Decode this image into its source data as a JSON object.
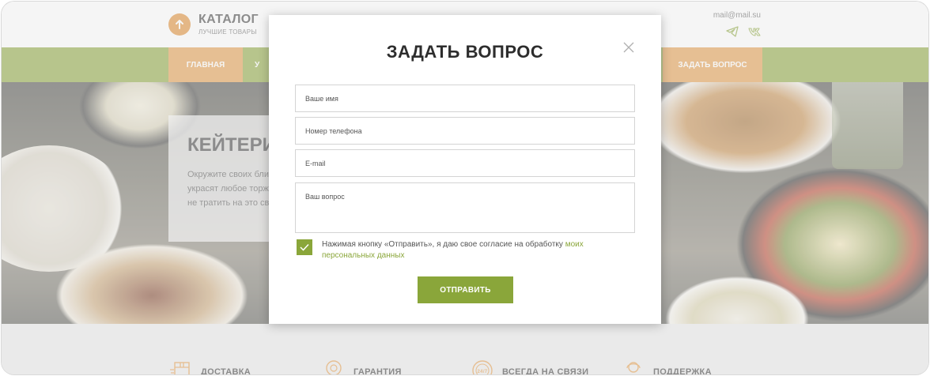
{
  "header": {
    "logo_title": "КАТАЛОГ",
    "logo_subtitle": "ЛУЧШИЕ ТОВАРЫ",
    "email": "mail@mail.su"
  },
  "nav": {
    "home": "ГЛАВНАЯ",
    "second_partial": "У",
    "ask": "ЗАДАТЬ ВОПРОС"
  },
  "hero": {
    "title_partial": "КЕЙТЕРИ",
    "text_lines": [
      "Окружите своих бли",
      "украсят любое торж",
      "не тратить на это св"
    ]
  },
  "features": [
    {
      "label": "ДОСТАВКА",
      "icon": "delivery-box-icon"
    },
    {
      "label": "ГАРАНТИЯ",
      "icon": "warranty-badge-icon"
    },
    {
      "label": "ВСЕГДА НА СВЯЗИ",
      "icon": "support-24-7-icon"
    },
    {
      "label": "ПОДДЕРЖКА",
      "icon": "support-operator-icon"
    }
  ],
  "modal": {
    "title": "ЗАДАТЬ ВОПРОС",
    "name_placeholder": "Ваше имя",
    "phone_placeholder": "Номер телефона",
    "email_placeholder": "E-mail",
    "question_placeholder": "Ваш вопрос",
    "consent_text": "Нажимая кнопку «Отправить», я даю свое согласие на обработку ",
    "consent_link": "моих персональных данных",
    "consent_checked": true,
    "submit_label": "ОТПРАВИТЬ"
  },
  "colors": {
    "accent_green": "#8aa63a",
    "accent_orange": "#e39a45"
  }
}
